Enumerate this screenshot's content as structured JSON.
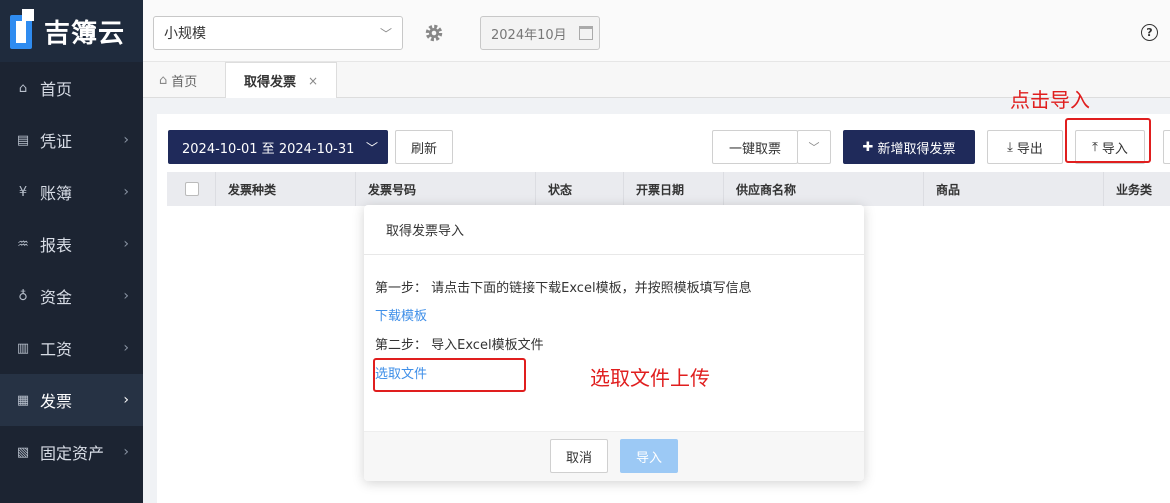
{
  "brand": {
    "name": "吉簿云"
  },
  "sidebar": {
    "items": [
      {
        "label": "首页",
        "icon": "home-icon",
        "glyph": "⌂"
      },
      {
        "label": "凭证",
        "icon": "voucher-icon",
        "glyph": "▤"
      },
      {
        "label": "账簿",
        "icon": "ledger-icon",
        "glyph": "¥"
      },
      {
        "label": "报表",
        "icon": "report-chart-icon",
        "glyph": "♒"
      },
      {
        "label": "资金",
        "icon": "fund-icon",
        "glyph": "♁"
      },
      {
        "label": "工资",
        "icon": "salary-icon",
        "glyph": "▥"
      },
      {
        "label": "发票",
        "icon": "invoice-icon",
        "glyph": "▦"
      },
      {
        "label": "固定资产",
        "icon": "fixed-asset-icon",
        "glyph": "▧"
      }
    ]
  },
  "topbar": {
    "taxpayer_type": "小规模",
    "period": "2024年10月"
  },
  "tabs": {
    "home": "首页",
    "current": "取得发票",
    "close": "×"
  },
  "toolbar": {
    "date_range": "2024-10-01 至 2024-10-31",
    "refresh": "刷新",
    "one_click": "一键取票",
    "add_new": "新增取得发票",
    "export": "导出",
    "import": "导入"
  },
  "table": {
    "headers": [
      "发票种类",
      "发票号码",
      "状态",
      "开票日期",
      "供应商名称",
      "商品",
      "业务类"
    ]
  },
  "modal": {
    "title": "取得发票导入",
    "step1": "第一步： 请点击下面的链接下载Excel模板，并按照模板填写信息",
    "download_link": "下载模板",
    "step2": "第二步： 导入Excel模板文件",
    "choose_file": "选取文件",
    "cancel": "取消",
    "confirm": "导入"
  },
  "annotations": {
    "click_import": "点击导入",
    "choose_upload": "选取文件上传",
    "color": "#e01e1e"
  }
}
